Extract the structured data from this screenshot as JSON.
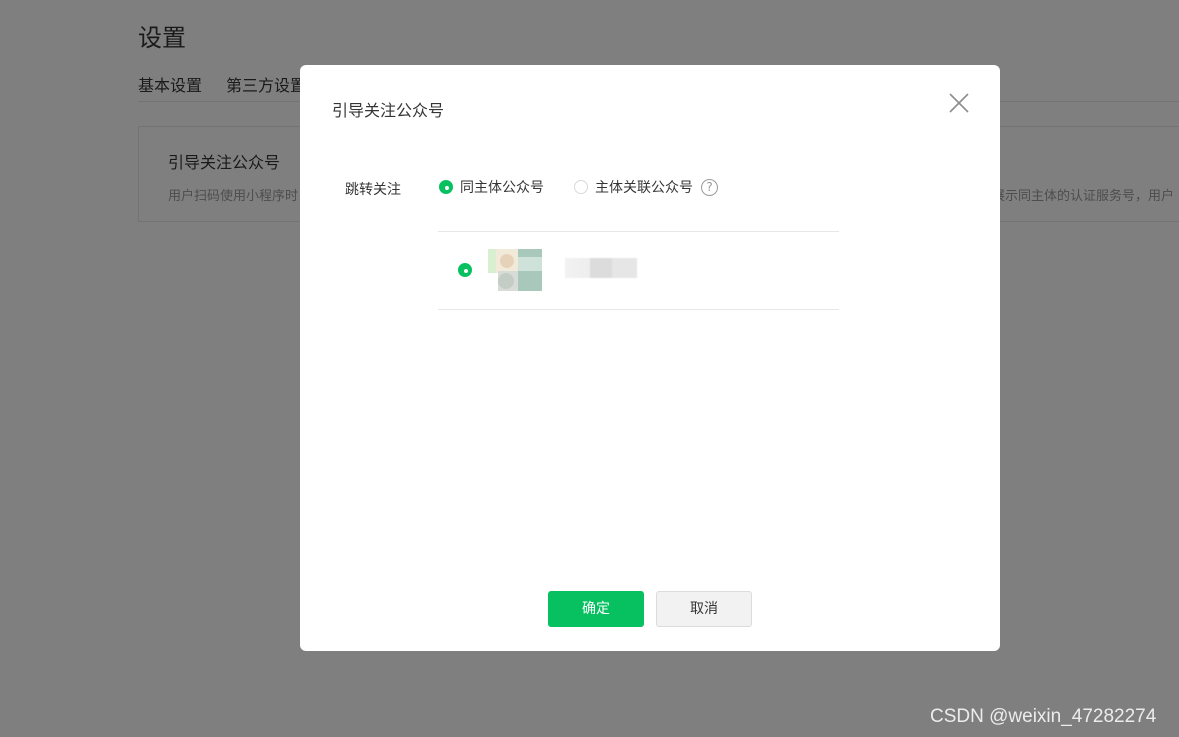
{
  "page": {
    "title": "设置",
    "tabs": [
      {
        "label": "基本设置"
      },
      {
        "label": "第三方设置"
      }
    ],
    "card": {
      "title": "引导关注公众号",
      "description_left": "用户扫码使用小程序时",
      "description_right": "展示同主体的认证服务号，用户"
    }
  },
  "dialog": {
    "title": "引导关注公众号",
    "form_label": "跳转关注",
    "options": [
      {
        "label": "同主体公众号",
        "checked": true
      },
      {
        "label": "主体关联公众号",
        "checked": false
      }
    ],
    "help_icon_glyph": "?",
    "account": {
      "name": "",
      "selected": true
    },
    "buttons": {
      "confirm": "确定",
      "cancel": "取消"
    }
  },
  "watermark": "CSDN @weixin_47282274",
  "colors": {
    "accent": "#07c160",
    "overlay": "rgba(0,0,0,0.5)"
  },
  "icons": {
    "close": "close-icon",
    "help": "question-circle-icon"
  }
}
